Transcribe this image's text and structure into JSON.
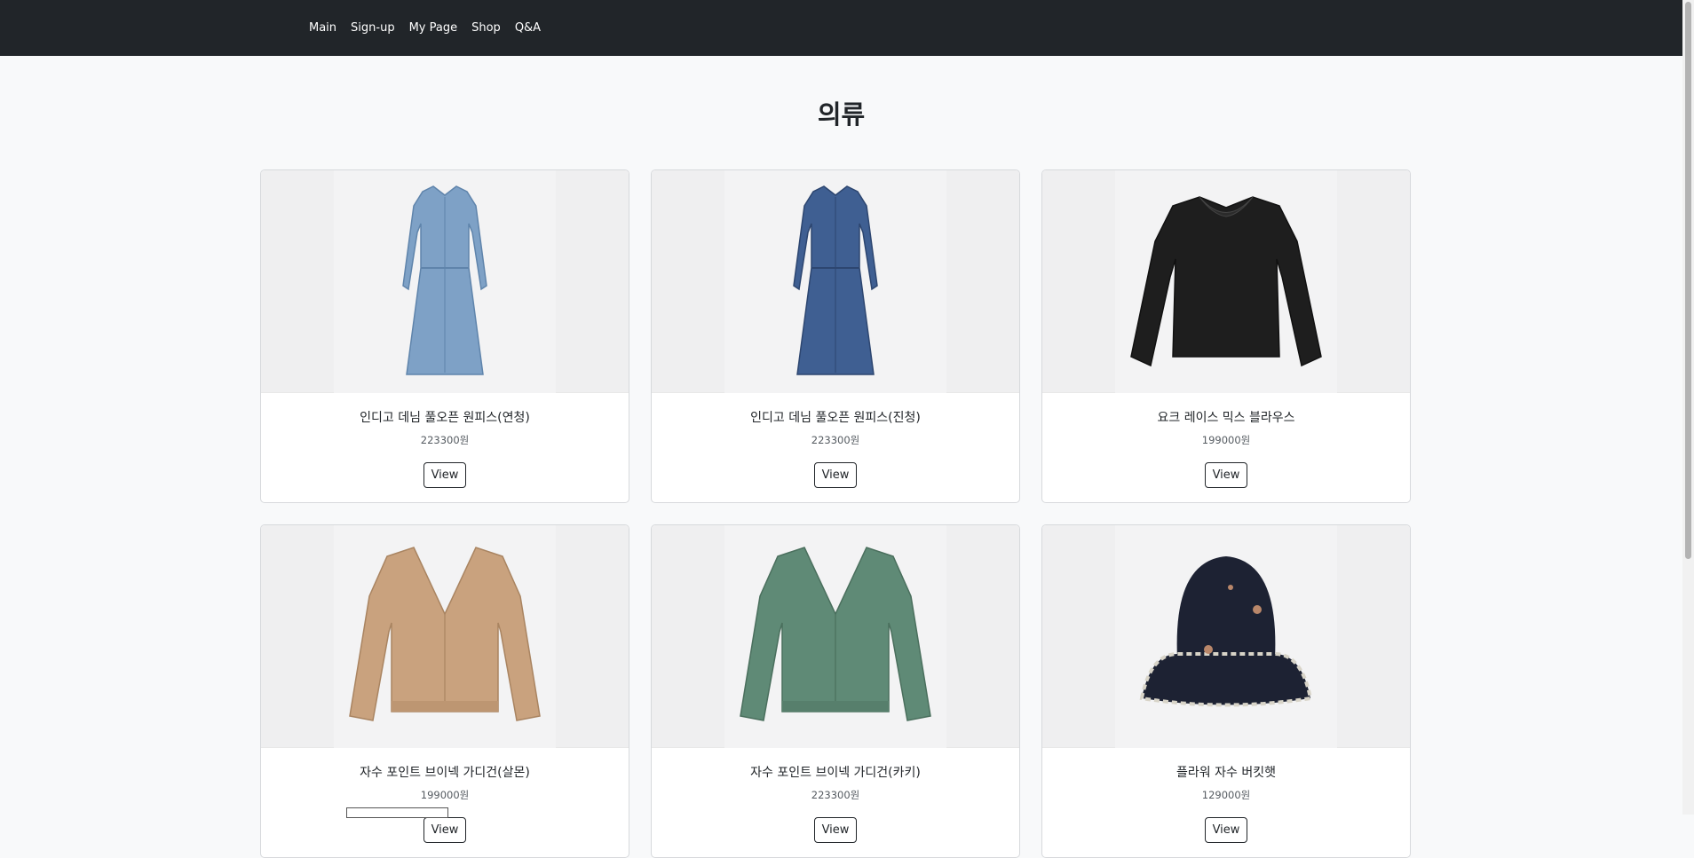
{
  "nav": {
    "links": [
      "Main",
      "Sign-up",
      "My Page",
      "Shop",
      "Q&A"
    ]
  },
  "page": {
    "title": "의류"
  },
  "products": [
    {
      "name": "인디고 데님 풀오픈 원피스(연청)",
      "price": "223300원",
      "button": "View",
      "image": "light-denim-dress",
      "color": "#7ea1c6"
    },
    {
      "name": "인디고 데님 풀오픈 원피스(진청)",
      "price": "223300원",
      "button": "View",
      "image": "dark-denim-dress",
      "color": "#3f5f92"
    },
    {
      "name": "요크 레이스 믹스 블라우스",
      "price": "199000원",
      "button": "View",
      "image": "black-lace-blouse",
      "color": "#1e1e1e"
    },
    {
      "name": "자수 포인트 브이넥 가디건(살몬)",
      "price": "199000원",
      "button": "View",
      "image": "salmon-cardigan",
      "color": "#c9a27e"
    },
    {
      "name": "자수 포인트 브이넥 가디건(카키)",
      "price": "223300원",
      "button": "View",
      "image": "khaki-cardigan",
      "color": "#5f8a76"
    },
    {
      "name": "플라워 자수 버킷햇",
      "price": "129000원",
      "button": "View",
      "image": "flower-bucket-hat",
      "color": "#1d2233"
    }
  ]
}
